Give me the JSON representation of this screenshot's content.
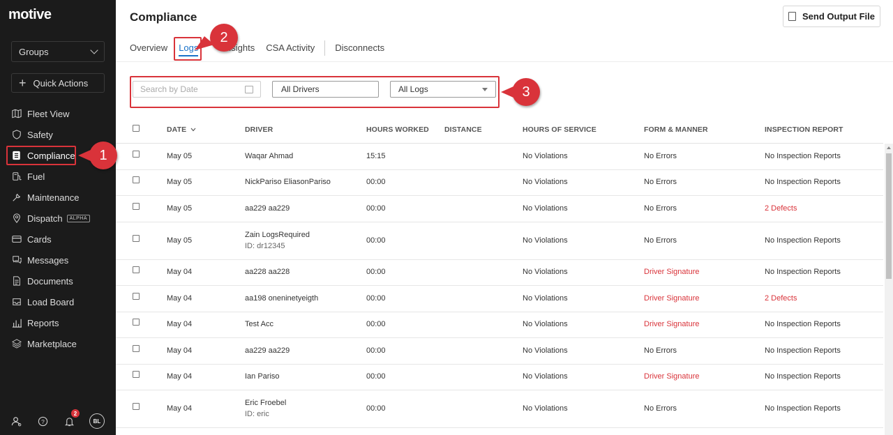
{
  "brand": {
    "logo": "motive"
  },
  "sidebar": {
    "groups_label": "Groups",
    "quick_actions_label": "Quick Actions",
    "items": [
      {
        "label": "Fleet View",
        "icon": "map-icon"
      },
      {
        "label": "Safety",
        "icon": "shield-icon"
      },
      {
        "label": "Compliance",
        "icon": "document-icon",
        "active": true
      },
      {
        "label": "Fuel",
        "icon": "fuel-icon"
      },
      {
        "label": "Maintenance",
        "icon": "wrench-icon"
      },
      {
        "label": "Dispatch",
        "icon": "pin-icon",
        "badge": "ALPHA"
      },
      {
        "label": "Cards",
        "icon": "card-icon"
      },
      {
        "label": "Messages",
        "icon": "chat-icon"
      },
      {
        "label": "Documents",
        "icon": "file-icon"
      },
      {
        "label": "Load Board",
        "icon": "inbox-icon"
      },
      {
        "label": "Reports",
        "icon": "bar-chart-icon"
      },
      {
        "label": "Marketplace",
        "icon": "layers-icon"
      }
    ],
    "notifications_count": "2",
    "avatar_initials": "BL"
  },
  "header": {
    "title": "Compliance",
    "send_output_label": "Send Output File",
    "tabs": [
      {
        "label": "Overview"
      },
      {
        "label": "Logs",
        "active": true
      },
      {
        "label": "Insights"
      },
      {
        "label": "CSA Activity"
      },
      {
        "label": "Disconnects"
      }
    ]
  },
  "filters": {
    "date_placeholder": "Search by Date",
    "drivers_value": "All Drivers",
    "logs_value": "All Logs"
  },
  "callouts": [
    "1",
    "2",
    "3"
  ],
  "table": {
    "columns": [
      "DATE",
      "DRIVER",
      "HOURS WORKED",
      "DISTANCE",
      "HOURS OF SERVICE",
      "FORM & MANNER",
      "INSPECTION REPORT"
    ],
    "rows": [
      {
        "date": "May 05",
        "driver": "Waqar Ahmad",
        "sub": "",
        "hours": "15:15",
        "distance": "",
        "hos": "No Violations",
        "form": "No Errors",
        "form_alert": false,
        "insp": "No Inspection Reports",
        "insp_alert": false
      },
      {
        "date": "May 05",
        "driver": "NickPariso EliasonPariso",
        "sub": "",
        "hours": "00:00",
        "distance": "",
        "hos": "No Violations",
        "form": "No Errors",
        "form_alert": false,
        "insp": "No Inspection Reports",
        "insp_alert": false
      },
      {
        "date": "May 05",
        "driver": "aa229 aa229",
        "sub": "",
        "hours": "00:00",
        "distance": "",
        "hos": "No Violations",
        "form": "No Errors",
        "form_alert": false,
        "insp": "2 Defects",
        "insp_alert": true
      },
      {
        "date": "May 05",
        "driver": "Zain LogsRequired",
        "sub": "ID: dr12345",
        "hours": "00:00",
        "distance": "",
        "hos": "No Violations",
        "form": "No Errors",
        "form_alert": false,
        "insp": "No Inspection Reports",
        "insp_alert": false
      },
      {
        "date": "May 04",
        "driver": "aa228 aa228",
        "sub": "",
        "hours": "00:00",
        "distance": "",
        "hos": "No Violations",
        "form": "Driver Signature",
        "form_alert": true,
        "insp": "No Inspection Reports",
        "insp_alert": false
      },
      {
        "date": "May 04",
        "driver": "aa198 oneninetyeigth",
        "sub": "",
        "hours": "00:00",
        "distance": "",
        "hos": "No Violations",
        "form": "Driver Signature",
        "form_alert": true,
        "insp": "2 Defects",
        "insp_alert": true
      },
      {
        "date": "May 04",
        "driver": "Test Acc",
        "sub": "",
        "hours": "00:00",
        "distance": "",
        "hos": "No Violations",
        "form": "Driver Signature",
        "form_alert": true,
        "insp": "No Inspection Reports",
        "insp_alert": false
      },
      {
        "date": "May 04",
        "driver": "aa229 aa229",
        "sub": "",
        "hours": "00:00",
        "distance": "",
        "hos": "No Violations",
        "form": "No Errors",
        "form_alert": false,
        "insp": "No Inspection Reports",
        "insp_alert": false
      },
      {
        "date": "May 04",
        "driver": "Ian Pariso",
        "sub": "",
        "hours": "00:00",
        "distance": "",
        "hos": "No Violations",
        "form": "Driver Signature",
        "form_alert": true,
        "insp": "No Inspection Reports",
        "insp_alert": false
      },
      {
        "date": "May 04",
        "driver": "Eric Froebel",
        "sub": "ID: eric",
        "hours": "00:00",
        "distance": "",
        "hos": "No Violations",
        "form": "No Errors",
        "form_alert": false,
        "insp": "No Inspection Reports",
        "insp_alert": false
      }
    ]
  }
}
